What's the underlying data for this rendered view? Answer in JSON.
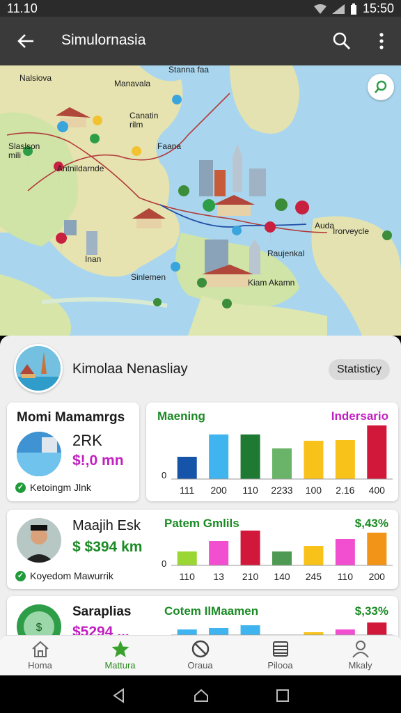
{
  "status": {
    "time": "11.10",
    "clock": "15:50"
  },
  "appbar": {
    "title": "Simulornasia"
  },
  "map": {
    "labels": [
      "Nalsiova",
      "Stanna faa",
      "Manavala",
      "Canatin\nrilm",
      "Slaslson\nmili",
      "Faana",
      "Antnildarnde",
      "Inan",
      "Sinlemen",
      "Raujenkal",
      "Kiam Akamn",
      "Auda",
      "Irorveycle"
    ]
  },
  "profile": {
    "name": "Kimolaa Nenasliay",
    "chip": "Statisticy"
  },
  "cards": [
    {
      "title": "Momi Mamamrgs",
      "big": "2RK",
      "value": "$!,0 mn",
      "foot": "Ketoingm Jlnk",
      "chart": {
        "title": "Maening",
        "right": "Indersario",
        "zero": "0",
        "categories": [
          "111",
          "200",
          "110",
          "2233",
          "100",
          "2.16",
          "400"
        ],
        "values": [
          32,
          64,
          64,
          44,
          55,
          56,
          77
        ],
        "colors": [
          "#1554a8",
          "#3fb4ee",
          "#1e7a32",
          "#69b468",
          "#f8c21a",
          "#f8c21a",
          "#d2183a"
        ]
      }
    },
    {
      "title": "Maajih Esk",
      "big": "",
      "value": "$ $394 km",
      "foot": "Koyedom Mawurrik",
      "chart": {
        "title": "Patem Gmlils",
        "right": "$,43%",
        "zero": "0",
        "categories": [
          "110",
          "13",
          "210",
          "140",
          "245",
          "110",
          "200"
        ],
        "values": [
          20,
          35,
          50,
          20,
          28,
          38,
          47
        ],
        "colors": [
          "#9ad634",
          "#f24fd0",
          "#d2183a",
          "#4f9a52",
          "#f8c21a",
          "#f24fd0",
          "#f29418"
        ]
      }
    },
    {
      "title": "Saraplias",
      "big": "",
      "value": "$5294 ...",
      "foot": "",
      "chart": {
        "title": "Cotem IlMaamen",
        "right": "$,33%",
        "zero": "",
        "categories": [],
        "values": [
          8,
          10,
          14,
          0,
          4,
          8,
          18
        ],
        "colors": [
          "#3fb4ee",
          "#3fb4ee",
          "#3fb4ee",
          "#3fb4ee",
          "#f8c21a",
          "#f24fd0",
          "#d2183a"
        ]
      }
    }
  ],
  "nav": [
    {
      "label": "Homa",
      "icon": "home-icon"
    },
    {
      "label": "Mattura",
      "icon": "star-icon"
    },
    {
      "label": "Oraua",
      "icon": "blocked-circle-icon"
    },
    {
      "label": "Pilooa",
      "icon": "stack-icon"
    },
    {
      "label": "Mkaly",
      "icon": "person-icon"
    }
  ],
  "colors": {
    "accent": "#2e8b22",
    "purple": "#c21fc2",
    "green": "#1a8a24"
  }
}
